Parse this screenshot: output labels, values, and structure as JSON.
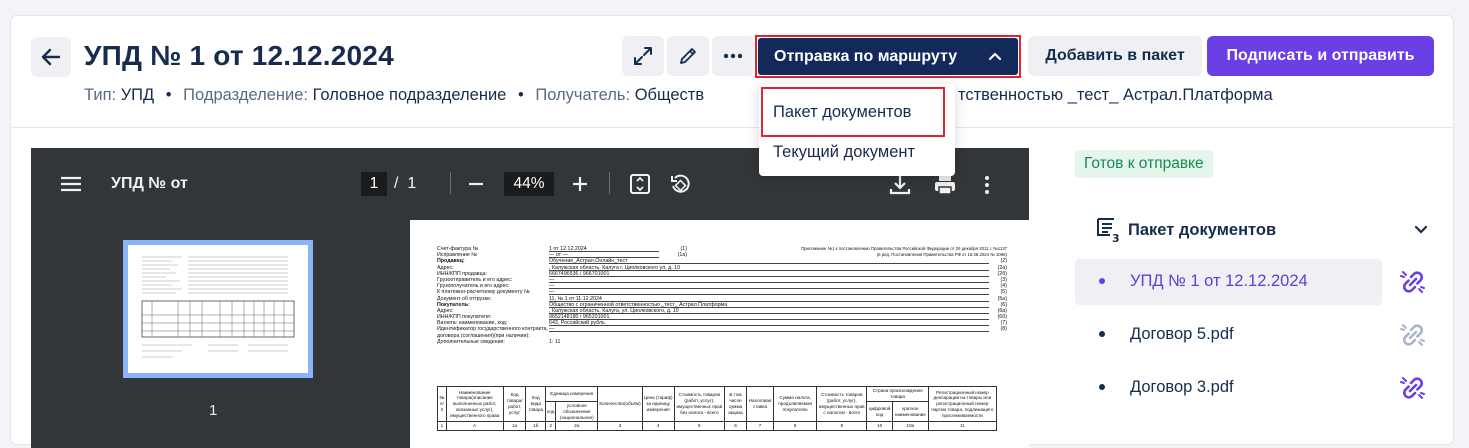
{
  "header": {
    "title": "УПД № 1 от 12.12.2024",
    "meta": {
      "type_label": "Тип:",
      "type_value": "УПД",
      "division_label": "Подразделение:",
      "division_value": "Головное подразделение",
      "recipient_label": "Получатель:",
      "recipient_value_left": "Обществ",
      "recipient_value_right": "тственностью _тест_ Астрал.Платформа"
    },
    "route_button": "Отправка по маршруту",
    "add_to_package": "Добавить в пакет",
    "sign_and_send": "Подписать и отправить"
  },
  "route_menu": {
    "items": [
      "Пакет документов",
      "Текущий документ"
    ]
  },
  "viewer": {
    "title": "УПД № от",
    "current_page": "1",
    "page_separator": "/",
    "total_pages": "1",
    "zoom": "44%",
    "thumbnail_page": "1"
  },
  "pdf": {
    "rows": [
      {
        "k": "Счет-фактура №",
        "v": "1 от 12.12.2024",
        "n": "(1)"
      },
      {
        "k": "Исправление №",
        "v": "— от —",
        "n": "(1а)"
      },
      {
        "k": "Продавец:",
        "v": "Обучение_Астрал.Онлайн_тест",
        "n": "(2)"
      },
      {
        "k": "Адрес:",
        "v": ", Калужская область, Калуга г, Циолковского ул, д. 10",
        "n": "(2а)"
      },
      {
        "k": "ИНН/КПП продавца:",
        "v": "6667496536 / 966701001",
        "n": "(2б)"
      },
      {
        "k": "Грузоотправитель и его адрес:",
        "v": "—",
        "n": "(3)"
      },
      {
        "k": "Грузополучатель и его адрес:",
        "v": "—",
        "n": "(4)"
      },
      {
        "k": "К платежно-расчетному документу №",
        "v": "—",
        "n": "(5)"
      },
      {
        "k": "Документ об отгрузке:",
        "v": "11, № 1 от 11.12.2024",
        "n": "(5а)"
      },
      {
        "k": "Покупатель:",
        "v": "Общество с ограниченной ответственностью _тест_ Астрал.Платформа",
        "n": "(6)"
      },
      {
        "k": "Адрес:",
        "v": ", Калужская область, Калуга, ул. Циолковского, д. 10",
        "n": "(6а)"
      },
      {
        "k": "ИНН/КПП покупателя:",
        "v": "9652148180 / 965201001",
        "n": "(6б)"
      },
      {
        "k": "Валюта: наименование, код:",
        "v": "643, Российский рубль",
        "n": "(7)"
      },
      {
        "k": "Идентификатор государственного контракта,",
        "v": "—",
        "n": "(8)"
      },
      {
        "k": "договора (соглашения)(при наличии):",
        "v": "",
        "n": ""
      },
      {
        "k": "Дополнительные сведения:",
        "v": "1: 11",
        "n": ""
      }
    ],
    "note": "Приложение №1 к постановлению Правительства Российской Федерации от 26 декабря 2011 г. №1137 (в ред. Постановления Правительства РФ от 16.08.2024 № 1096)",
    "table_head": [
      "№ п/п",
      "Наименование товара(описание выполненных работ, оказанных услуг), имущественного права",
      "Код товара/ работ, услуг",
      "Код вида товара",
      "Единица измерения",
      "Количество(объём)",
      "Цена (тариф) за единицу измерения",
      "Стоимость товаров (работ, услуг), имущественных прав без налога - всего",
      "В том числе сумма акциза",
      "Налоговая ставка",
      "Сумма налога, предъявляемая покупателю",
      "Стоимость товаров (работ, услуг), имущественных прав с налогом - всего",
      "Страна происхождения товара",
      "Регистрационный номер декларации на товары или регистрационный номер партии товара, подлежащего прослеживаемости"
    ],
    "table_sub": [
      "код",
      "условное обозначение (национальное)",
      "цифровой код",
      "краткое наименование"
    ],
    "table_nums": [
      "1",
      "А",
      "1а",
      "1б",
      "2",
      "2а",
      "3",
      "4",
      "5",
      "6",
      "7",
      "8",
      "9",
      "10",
      "10а",
      "11"
    ]
  },
  "sidebar": {
    "status": "Готов к отправке",
    "package_title": "Пакет документов",
    "documents": [
      {
        "name": "УПД № 1 от 12.12.2024",
        "active": true,
        "link_color": "#6a3fe6"
      },
      {
        "name": "Договор 5.pdf",
        "active": false,
        "link_color": "#a9b4c6"
      },
      {
        "name": "Договор 3.pdf",
        "active": false,
        "link_color": "#6a3fe6"
      }
    ]
  },
  "colors": {
    "primary": "#12295a",
    "accent": "#6a3fe6",
    "highlight_outline": "#e0232e",
    "status_green": "#1a8a51"
  }
}
